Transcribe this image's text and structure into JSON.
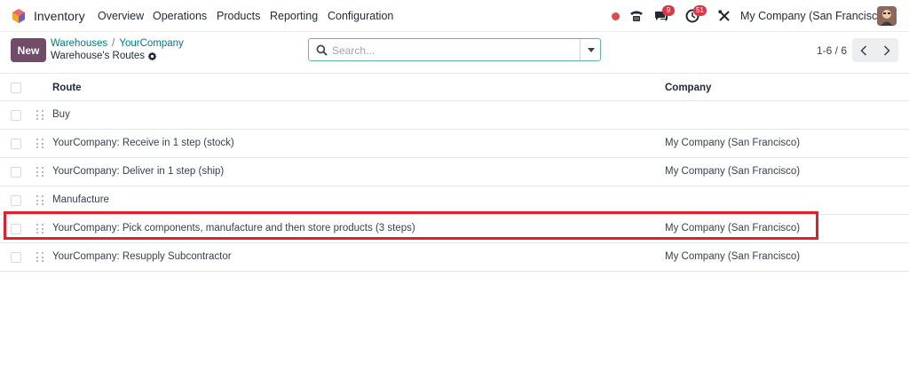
{
  "navbar": {
    "app_name": "Inventory",
    "menu": [
      "Overview",
      "Operations",
      "Products",
      "Reporting",
      "Configuration"
    ],
    "messages_badge": "9",
    "activities_badge": "51",
    "company": "My Company (San Francisco)"
  },
  "control_panel": {
    "new_label": "New",
    "breadcrumb": [
      "Warehouses",
      "YourCompany"
    ],
    "breadcrumb_sep": "/",
    "title": "Warehouse's Routes",
    "search_placeholder": "Search...",
    "pager": "1-6 / 6"
  },
  "table": {
    "columns": {
      "route": "Route",
      "company": "Company"
    },
    "rows": [
      {
        "route": "Buy",
        "company": ""
      },
      {
        "route": "YourCompany: Receive in 1 step (stock)",
        "company": "My Company (San Francisco)"
      },
      {
        "route": "YourCompany: Deliver in 1 step (ship)",
        "company": "My Company (San Francisco)"
      },
      {
        "route": "Manufacture",
        "company": ""
      },
      {
        "route": "YourCompany: Pick components, manufacture and then store products (3 steps)",
        "company": "My Company (San Francisco)"
      },
      {
        "route": "YourCompany: Resupply Subcontractor",
        "company": "My Company (San Francisco)"
      }
    ]
  },
  "colors": {
    "brand": "#714b67",
    "link": "#017e84",
    "highlight": "#e0202a"
  }
}
